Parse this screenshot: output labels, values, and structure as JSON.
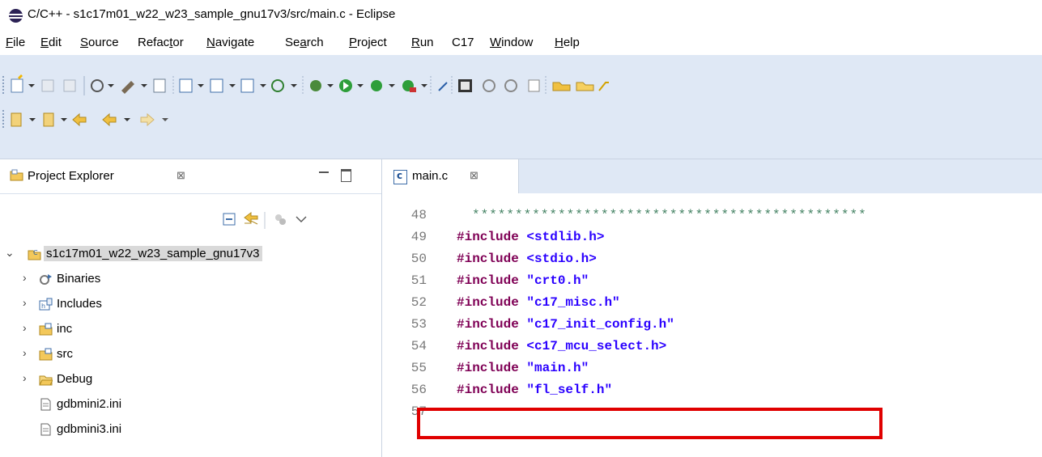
{
  "window": {
    "title": "C/C++ - s1c17m01_w22_w23_sample_gnu17v3/src/main.c - Eclipse"
  },
  "menubar": {
    "items": [
      {
        "mnemonic": "F",
        "rest": "ile"
      },
      {
        "mnemonic": "E",
        "rest": "dit"
      },
      {
        "mnemonic": "S",
        "rest": "ource"
      },
      {
        "pre": "Refac",
        "mnemonic": "t",
        "rest": "or"
      },
      {
        "mnemonic": "N",
        "rest": "avigate"
      },
      {
        "pre": "Se",
        "mnemonic": "a",
        "rest": "rch"
      },
      {
        "mnemonic": "P",
        "rest": "roject"
      },
      {
        "mnemonic": "R",
        "rest": "un"
      },
      {
        "pre": "C17",
        "mnemonic": "",
        "rest": ""
      },
      {
        "mnemonic": "W",
        "rest": "indow"
      },
      {
        "mnemonic": "H",
        "rest": "elp"
      }
    ]
  },
  "project_explorer": {
    "title": "Project Explorer",
    "close_symbol": "⊠",
    "tree": [
      {
        "label": "s1c17m01_w22_w23_sample_gnu17v3",
        "icon": "project-icon",
        "expanded": true
      },
      {
        "label": "Binaries",
        "icon": "binaries-icon"
      },
      {
        "label": "Includes",
        "icon": "includes-icon"
      },
      {
        "label": "inc",
        "icon": "folder-src-icon"
      },
      {
        "label": "src",
        "icon": "folder-src-icon"
      },
      {
        "label": "Debug",
        "icon": "folder-icon"
      },
      {
        "label": "gdbmini2.ini",
        "icon": "file-icon"
      },
      {
        "label": "gdbmini3.ini",
        "icon": "file-icon"
      }
    ]
  },
  "editor": {
    "tab_label": "main.c",
    "tab_icon_text": "c",
    "tab_close_symbol": "⊠",
    "lines": [
      {
        "num": "48",
        "kw": "",
        "arg": "",
        "comment": "**********************************************"
      },
      {
        "num": "49",
        "kw": "#include",
        "arg": "<stdlib.h>"
      },
      {
        "num": "50",
        "kw": "#include",
        "arg": "<stdio.h>"
      },
      {
        "num": "51",
        "kw": "#include",
        "arg": "\"crt0.h\""
      },
      {
        "num": "52",
        "kw": "#include",
        "arg": "\"c17_misc.h\""
      },
      {
        "num": "53",
        "kw": "#include",
        "arg": "\"c17_init_config.h\""
      },
      {
        "num": "54",
        "kw": "#include",
        "arg": "<c17_mcu_select.h>"
      },
      {
        "num": "55",
        "kw": "#include",
        "arg": "\"main.h\""
      },
      {
        "num": "56",
        "kw": "#include",
        "arg": "\"fl_self.h\""
      },
      {
        "num": "57",
        "kw": "",
        "arg": ""
      }
    ]
  },
  "colors": {
    "toolbar_bg": "#dfe8f5",
    "keyword": "#7f0055",
    "string": "#2a00ff",
    "highlight": "#e00000"
  }
}
